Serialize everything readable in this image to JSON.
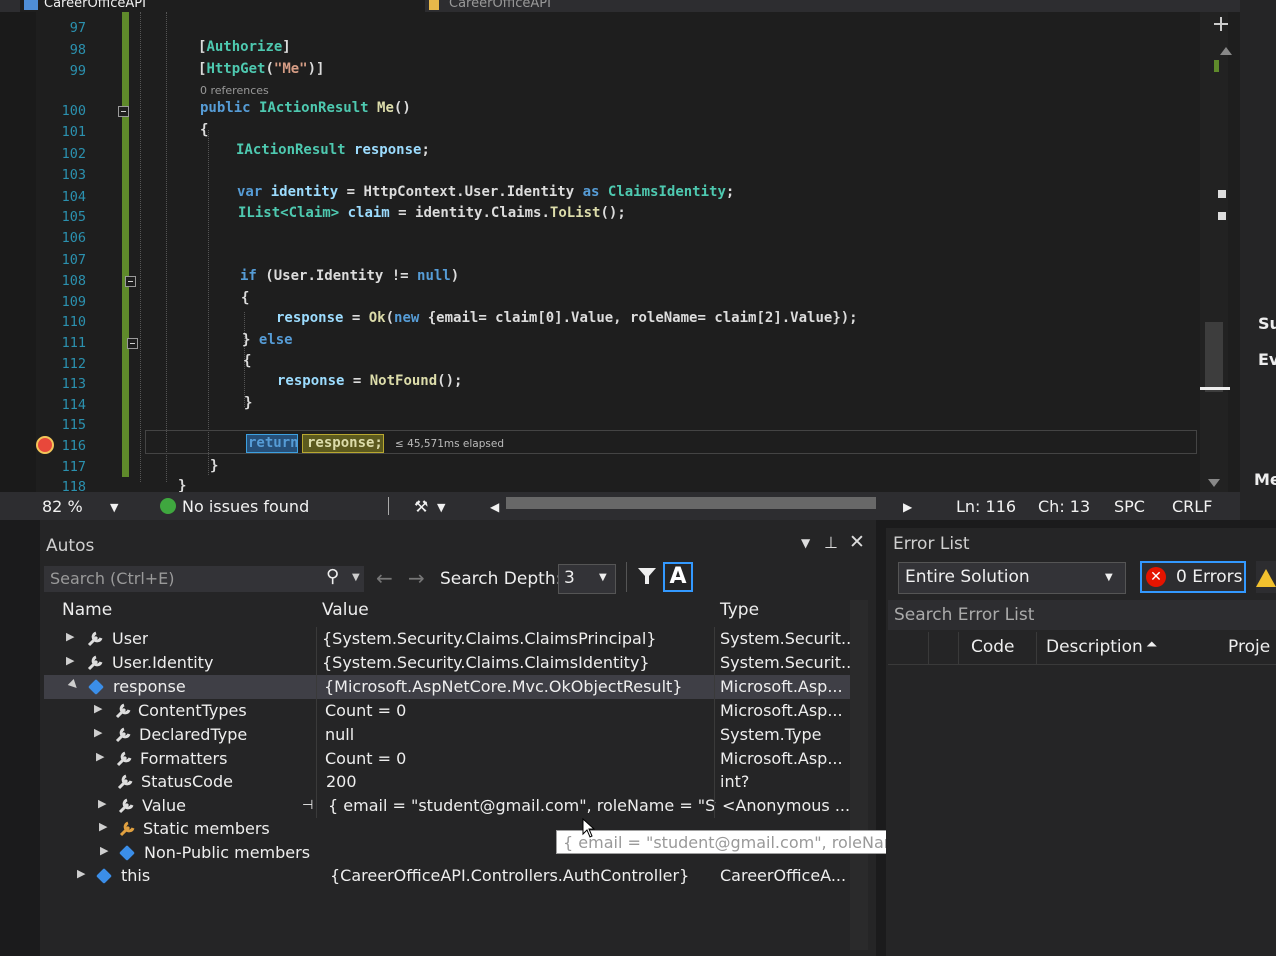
{
  "tabs": [
    {
      "label": "CareerOfficeAPI"
    },
    {
      "label": "CareerOfficeAPI"
    }
  ],
  "editor": {
    "line_numbers": [
      "97",
      "98",
      "99",
      "100",
      "101",
      "102",
      "103",
      "104",
      "105",
      "106",
      "107",
      "108",
      "109",
      "110",
      "111",
      "112",
      "113",
      "114",
      "115",
      "116",
      "117",
      "118"
    ],
    "references_label": "0 references",
    "elapsed": "≤ 45,571ms elapsed",
    "code": {
      "l98_a": "[",
      "l98_b": "Authorize",
      "l98_c": "]",
      "l99_a": "[",
      "l99_b": "HttpGet",
      "l99_c": "(",
      "l99_d": "\"Me\"",
      "l99_e": ")]",
      "l100_a": "public ",
      "l100_b": "IActionResult ",
      "l100_c": "Me",
      "l100_d": "()",
      "l101": "{",
      "l102_a": "IActionResult ",
      "l102_b": "response",
      "l102_c": ";",
      "l104_a": "var ",
      "l104_b": "identity",
      "l104_c": " = HttpContext.User.Identity ",
      "l104_d": "as ",
      "l104_e": "ClaimsIdentity",
      "l104_f": ";",
      "l105_a": "IList<",
      "l105_b": "Claim",
      "l105_c": "> ",
      "l105_d": "claim",
      "l105_e": " = identity.Claims.",
      "l105_f": "ToList",
      "l105_g": "();",
      "l108_a": "if ",
      "l108_b": "(User.Identity != ",
      "l108_c": "null",
      "l108_d": ")",
      "l109": "{",
      "l110_a": "response",
      "l110_b": " = ",
      "l110_c": "Ok",
      "l110_d": "(",
      "l110_e": "new ",
      "l110_f": "{email= claim[0].Value, roleName= claim[2].Value});",
      "l111_a": "} ",
      "l111_b": "else",
      "l112": "{",
      "l113_a": "response",
      "l113_b": " = ",
      "l113_c": "NotFound",
      "l113_d": "();",
      "l114": "}",
      "l116_a": "return",
      "l116_b": " response;",
      "l117": "}",
      "l118": "}"
    }
  },
  "statusbar": {
    "zoom": "82 %",
    "issues": "No issues found",
    "line": "Ln: 116",
    "col": "Ch: 13",
    "whitespace": "SPC",
    "eol": "CRLF"
  },
  "right_strip": {
    "tab1": "Su",
    "tab2": "Ev",
    "tab3": "Me"
  },
  "autos": {
    "title": "Autos",
    "search_placeholder": "Search (Ctrl+E)",
    "search_depth_label": "Search Depth:",
    "search_depth_value": "3",
    "columns": {
      "name": "Name",
      "value": "Value",
      "type": "Type"
    },
    "rows": [
      {
        "name": "User",
        "value": "{System.Security.Claims.ClaimsPrincipal}",
        "type": "System.Securit..."
      },
      {
        "name": "User.Identity",
        "value": "{System.Security.Claims.ClaimsIdentity}",
        "type": "System.Securit..."
      },
      {
        "name": "response",
        "value": "{Microsoft.AspNetCore.Mvc.OkObjectResult}",
        "type": "Microsoft.Asp..."
      },
      {
        "name": "ContentTypes",
        "value": "Count = 0",
        "type": "Microsoft.Asp..."
      },
      {
        "name": "DeclaredType",
        "value": "null",
        "type": "System.Type"
      },
      {
        "name": "Formatters",
        "value": "Count = 0",
        "type": "Microsoft.Asp..."
      },
      {
        "name": "StatusCode",
        "value": "200",
        "type": "int?"
      },
      {
        "name": "Value",
        "value": "{ email = \"student@gmail.com\", roleName = \"Stu...",
        "type": "<Anonymous ..."
      },
      {
        "name": "Static members",
        "value": "",
        "type": ""
      },
      {
        "name": "Non-Public members",
        "value": "",
        "type": ""
      },
      {
        "name": "this",
        "value": "{CareerOfficeAPI.Controllers.AuthController}",
        "type": "CareerOfficeA..."
      }
    ],
    "tooltip": "{ email = \"student@gmail.com\", roleName = \"Student\" }"
  },
  "error_list": {
    "title": "Error List",
    "scope": "Entire Solution",
    "errors": "0 Errors",
    "search_placeholder": "Search Error List",
    "columns": {
      "code": "Code",
      "description": "Description",
      "project": "Proje"
    }
  },
  "colors": {
    "accent": "#3399ff",
    "keyword": "#569cd6",
    "type": "#4ec9b0",
    "string": "#d69d85",
    "error": "#e51400",
    "ok": "#3fa73f"
  }
}
